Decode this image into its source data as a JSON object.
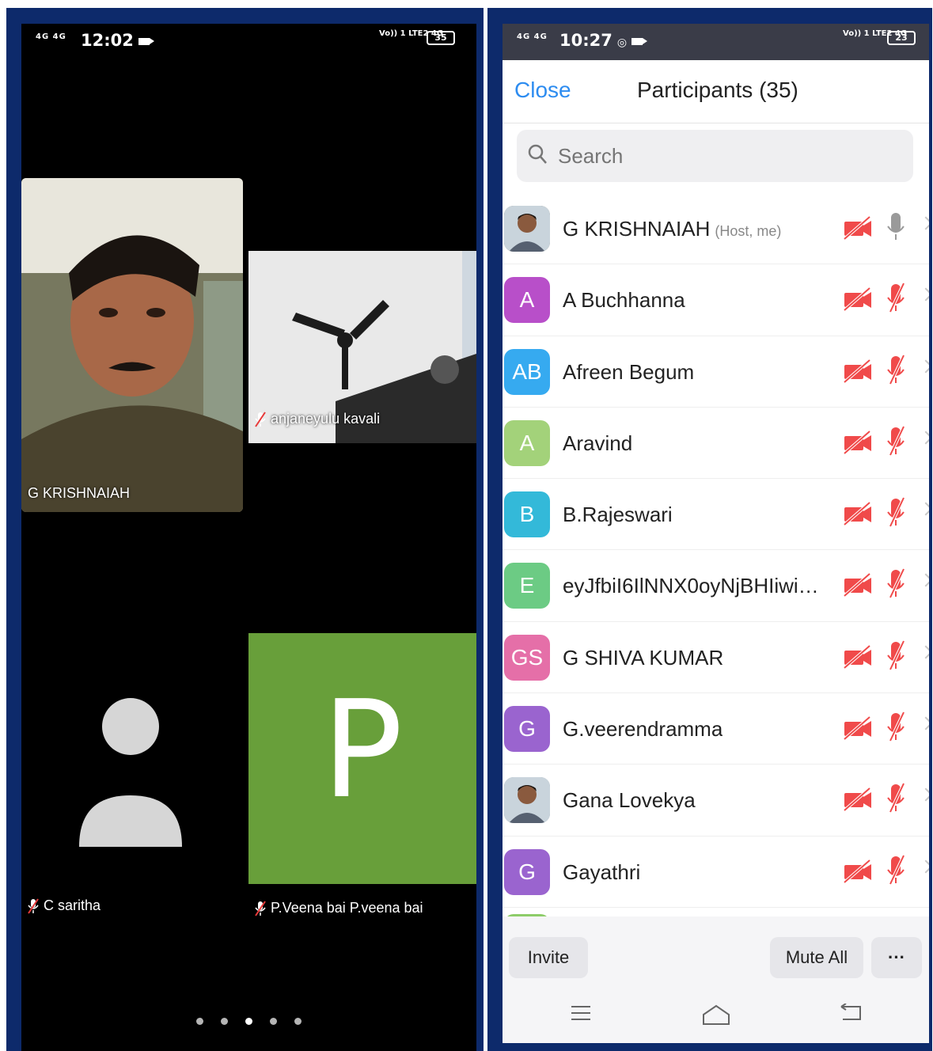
{
  "left": {
    "status": {
      "signal": "4G 4G",
      "time": "12:02",
      "volte": "Vo)) 1 LTE2 4G",
      "battery": "35"
    },
    "tiles": {
      "host": {
        "name": "G KRISHNAIAH"
      },
      "anjaneyulu": {
        "name": "anjaneyulu kavali"
      },
      "saritha": {
        "name": "C saritha"
      },
      "veena": {
        "name": "P.Veena bai P.veena bai",
        "initial": "P",
        "color": "#689f3a"
      }
    },
    "pages": {
      "count": 5,
      "active_index": 2
    }
  },
  "right": {
    "status": {
      "signal": "4G 4G",
      "time": "10:27",
      "volte": "Vo)) 1 LTE2 4G",
      "battery": "23"
    },
    "header": {
      "close_label": "Close",
      "title": "Participants (35)"
    },
    "search": {
      "placeholder": "Search"
    },
    "participants": [
      {
        "initials": "",
        "name": "G KRISHNAIAH",
        "tag": "(Host, me)",
        "color": "#7a7a6a",
        "photo": true,
        "mic_muted": false
      },
      {
        "initials": "A",
        "name": "A Buchhanna",
        "tag": "",
        "color": "#b84fc9"
      },
      {
        "initials": "AB",
        "name": "Afreen Begum",
        "tag": "",
        "color": "#36aaf0"
      },
      {
        "initials": "A",
        "name": "Aravind",
        "tag": "",
        "color": "#a3d27a"
      },
      {
        "initials": "B",
        "name": "B.Rajeswari",
        "tag": "",
        "color": "#33b9d9"
      },
      {
        "initials": "E",
        "name": "eyJfbiI6IlNNX0oyNjBHIiwiX...",
        "tag": "",
        "color": "#6ccb84"
      },
      {
        "initials": "GS",
        "name": "G SHIVA KUMAR",
        "tag": "",
        "color": "#e56fa8"
      },
      {
        "initials": "G",
        "name": "G.veerendramma",
        "tag": "",
        "color": "#9a64cf"
      },
      {
        "initials": "",
        "name": "Gana Lovekya",
        "tag": "",
        "color": "#8a9aa8",
        "photo": true
      },
      {
        "initials": "G",
        "name": "Gayathri",
        "tag": "",
        "color": "#9a64cf"
      }
    ],
    "footer": {
      "invite_label": "Invite",
      "mute_all_label": "Mute All",
      "more_label": "···"
    },
    "accent": "#2d8cf0",
    "muted_color": "#f04a4a"
  }
}
